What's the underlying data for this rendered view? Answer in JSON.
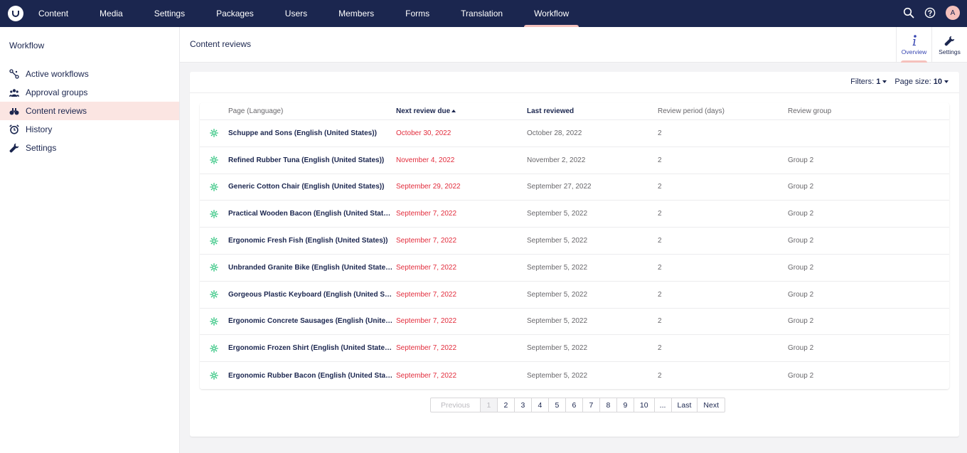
{
  "nav": {
    "items": [
      "Content",
      "Media",
      "Settings",
      "Packages",
      "Users",
      "Members",
      "Forms",
      "Translation",
      "Workflow"
    ],
    "active_index": 8,
    "avatar_initial": "A"
  },
  "sidebar": {
    "title": "Workflow",
    "items": [
      {
        "label": "Active workflows",
        "icon": "workflow-icon"
      },
      {
        "label": "Approval groups",
        "icon": "users-icon"
      },
      {
        "label": "Content reviews",
        "icon": "binoculars-icon",
        "active": true
      },
      {
        "label": "History",
        "icon": "alarm-clock-icon"
      },
      {
        "label": "Settings",
        "icon": "wrench-icon"
      }
    ]
  },
  "header": {
    "title": "Content reviews",
    "tabs": [
      {
        "label": "Overview",
        "icon": "info-icon",
        "active": true
      },
      {
        "label": "Settings",
        "icon": "wrench-icon"
      }
    ]
  },
  "toolbar": {
    "filters_label": "Filters:",
    "filters_value": "1",
    "page_size_label": "Page size:",
    "page_size_value": "10"
  },
  "table": {
    "columns": [
      "Page (Language)",
      "Next review due",
      "Last reviewed",
      "Review period (days)",
      "Review group"
    ],
    "rows": [
      {
        "page": "Schuppe and Sons (English (United States))",
        "due": "October 30, 2022",
        "last": "October 28, 2022",
        "period": "2",
        "group": ""
      },
      {
        "page": "Refined Rubber Tuna (English (United States))",
        "due": "November 4, 2022",
        "last": "November 2, 2022",
        "period": "2",
        "group": "Group 2"
      },
      {
        "page": "Generic Cotton Chair (English (United States))",
        "due": "September 29, 2022",
        "last": "September 27, 2022",
        "period": "2",
        "group": "Group 2"
      },
      {
        "page": "Practical Wooden Bacon (English (United States))",
        "due": "September 7, 2022",
        "last": "September 5, 2022",
        "period": "2",
        "group": "Group 2"
      },
      {
        "page": "Ergonomic Fresh Fish (English (United States))",
        "due": "September 7, 2022",
        "last": "September 5, 2022",
        "period": "2",
        "group": "Group 2"
      },
      {
        "page": "Unbranded Granite Bike (English (United States))",
        "due": "September 7, 2022",
        "last": "September 5, 2022",
        "period": "2",
        "group": "Group 2"
      },
      {
        "page": "Gorgeous Plastic Keyboard (English (United States))",
        "due": "September 7, 2022",
        "last": "September 5, 2022",
        "period": "2",
        "group": "Group 2"
      },
      {
        "page": "Ergonomic Concrete Sausages (English (United States))",
        "due": "September 7, 2022",
        "last": "September 5, 2022",
        "period": "2",
        "group": "Group 2"
      },
      {
        "page": "Ergonomic Frozen Shirt (English (United States))",
        "due": "September 7, 2022",
        "last": "September 5, 2022",
        "period": "2",
        "group": "Group 2"
      },
      {
        "page": "Ergonomic Rubber Bacon (English (United States))",
        "due": "September 7, 2022",
        "last": "September 5, 2022",
        "period": "2",
        "group": "Group 2"
      }
    ]
  },
  "pagination": {
    "previous": "Previous",
    "pages": [
      "1",
      "2",
      "3",
      "4",
      "5",
      "6",
      "7",
      "8",
      "9",
      "10",
      "..."
    ],
    "current": "1",
    "last": "Last",
    "next": "Next"
  },
  "colors": {
    "nav_bg": "#1b264f",
    "accent": "#f5c1bc",
    "due_red": "#e22c3c",
    "page_icon_green": "#2bc37c"
  }
}
